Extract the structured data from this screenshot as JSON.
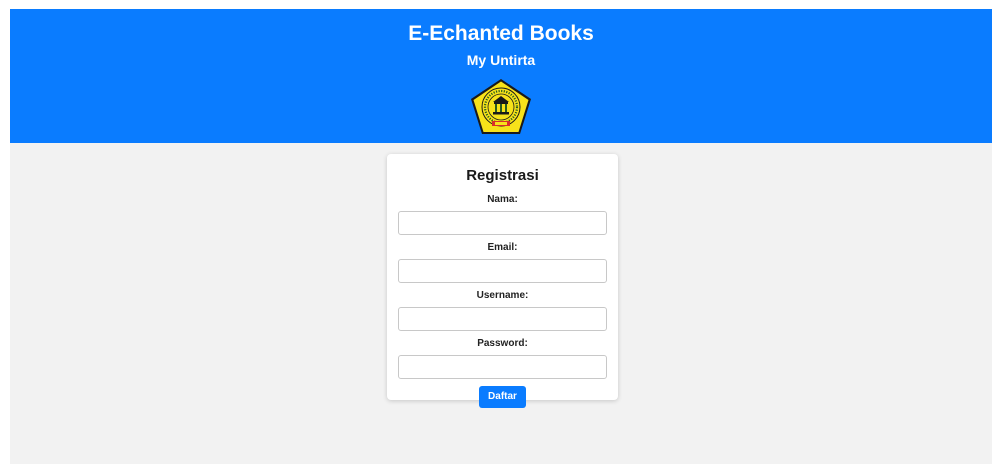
{
  "header": {
    "title": "E-Echanted Books",
    "subtitle": "My Untirta",
    "logo_icon": "university-seal-logo",
    "logo_text": "UNIVERSITAS SULTAN AGENG TIRTAYASA"
  },
  "form": {
    "title": "Registrasi",
    "fields": [
      {
        "label": "Nama:",
        "value": ""
      },
      {
        "label": "Email:",
        "value": ""
      },
      {
        "label": "Username:",
        "value": ""
      },
      {
        "label": "Password:",
        "value": ""
      }
    ],
    "submit_label": "Daftar"
  },
  "colors": {
    "header_bg": "#0a7cff",
    "page_bg": "#f2f2f2",
    "button_bg": "#0a7cff"
  }
}
